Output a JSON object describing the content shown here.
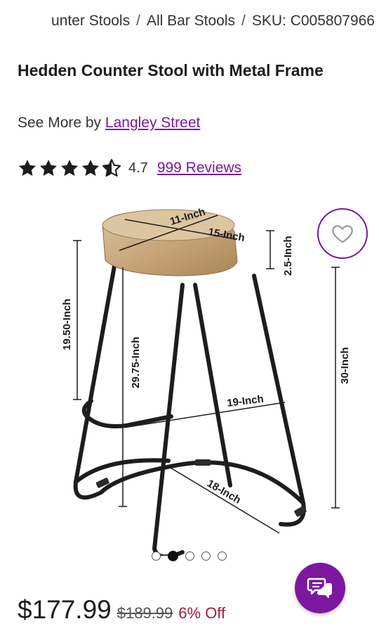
{
  "breadcrumb": {
    "items": [
      "unter Stools",
      "All Bar Stools",
      "SKU: C005807966"
    ],
    "separator": "/"
  },
  "product": {
    "title": "Hedden Counter Stool with Metal Frame",
    "see_more_prefix": "See More by",
    "brand": "Langley Street",
    "rating_value": "4.7",
    "reviews_label": "999 Reviews",
    "stars": 4.5
  },
  "image": {
    "dimension_labels": {
      "seat_width": "11-Inch",
      "seat_depth": "15-Inch",
      "seat_thickness": "2.5-Inch",
      "leg_height": "19.50-Inch",
      "seat_height": "29.75-Inch",
      "total_height": "30-Inch",
      "base_width": "19-Inch",
      "base_depth": "18-Inch"
    },
    "carousel_count": 5,
    "carousel_active_index": 1
  },
  "pricing": {
    "price": "$177.99",
    "original_price": "$189.99",
    "discount": "6% Off"
  },
  "icons": {
    "favorite": "heart-icon",
    "chat": "chat-icon",
    "star": "star-icon"
  },
  "colors": {
    "accent": "#7b189f",
    "discount": "#a51c3a"
  }
}
